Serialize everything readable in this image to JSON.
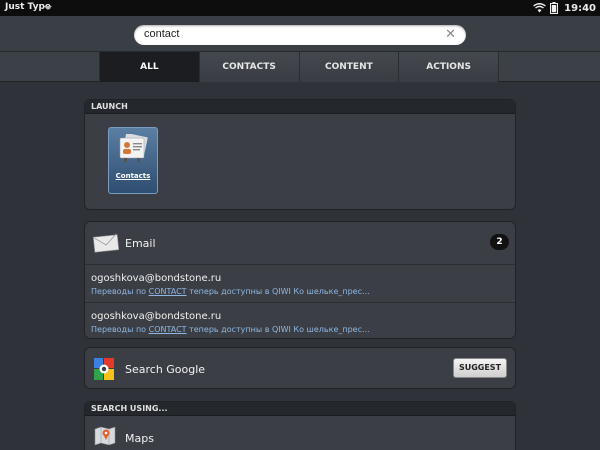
{
  "statusbar": {
    "app_name": "Just Type",
    "time": "19:40"
  },
  "search": {
    "query": "contact",
    "clear_glyph": "✕"
  },
  "tabs": [
    {
      "label": "ALL",
      "active": true
    },
    {
      "label": "CONTACTS",
      "active": false
    },
    {
      "label": "CONTENT",
      "active": false
    },
    {
      "label": "ACTIONS",
      "active": false
    }
  ],
  "launch": {
    "title": "LAUNCH",
    "app": {
      "label": "Contacts",
      "icon": "contacts-icon"
    }
  },
  "email": {
    "label": "Email",
    "count": "2",
    "icon": "envelope-icon",
    "results": [
      {
        "from": "ogoshkova@bondstone.ru",
        "snippet_pre": "Переводы по ",
        "snippet_hl": "CONTACT",
        "snippet_post": " теперь доступны в QIWI Ко шельке_прес…"
      },
      {
        "from": "ogoshkova@bondstone.ru",
        "snippet_pre": "Переводы по ",
        "snippet_hl": "CONTACT",
        "snippet_post": " теперь доступны в QIWI Ко шельке_прес…"
      }
    ]
  },
  "google": {
    "label": "Search Google",
    "button": "SUGGEST",
    "icon": "google-icon"
  },
  "search_using": {
    "title": "SEARCH USING...",
    "items": [
      {
        "label": "Maps",
        "icon": "maps-icon"
      }
    ]
  },
  "colors": {
    "accent_link": "#8fb6e2",
    "background": "#2f3339"
  }
}
